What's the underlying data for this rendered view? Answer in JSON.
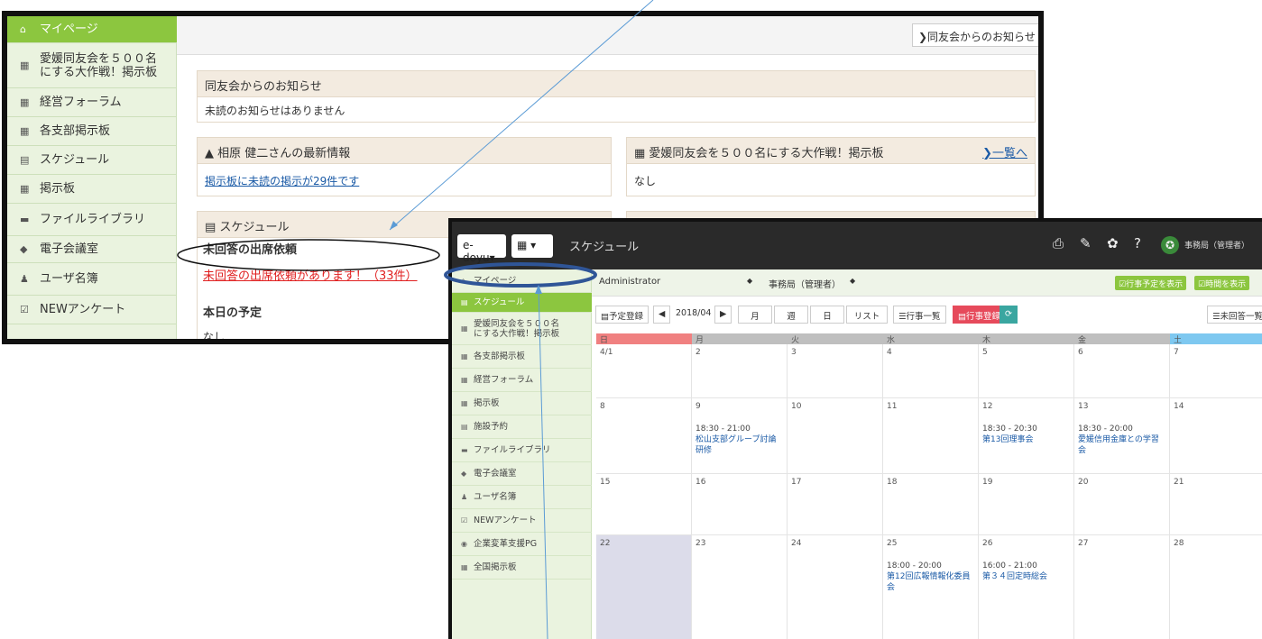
{
  "back": {
    "sidebar": [
      {
        "icon": "home-icon",
        "glyph": "⌂",
        "label": "マイページ",
        "active": true
      },
      {
        "icon": "board-icon",
        "glyph": "▦",
        "label": "愛媛同友会を５００名\nにする大作戦！掲示板"
      },
      {
        "icon": "board-icon",
        "glyph": "▦",
        "label": "経営フォーラム"
      },
      {
        "icon": "board-icon",
        "glyph": "▦",
        "label": "各支部掲示板"
      },
      {
        "icon": "calendar-icon",
        "glyph": "▤",
        "label": "スケジュール"
      },
      {
        "icon": "board-icon",
        "glyph": "▦",
        "label": "掲示板"
      },
      {
        "icon": "folder-icon",
        "glyph": "▬",
        "label": "ファイルライブラリ"
      },
      {
        "icon": "meeting-icon",
        "glyph": "◆",
        "label": "電子会議室"
      },
      {
        "icon": "users-icon",
        "glyph": "♟",
        "label": "ユーザ名簿"
      },
      {
        "icon": "survey-icon",
        "glyph": "☑",
        "label": "NEWアンケート"
      }
    ],
    "top_link": "❯同友会からのお知らせ",
    "news": {
      "title": "同友会からのお知らせ",
      "body": "未読のお知らせはありません"
    },
    "latest": {
      "title": "▲ 相原 健二さんの最新情報",
      "link": "掲示板に未読の掲示が29件です"
    },
    "board": {
      "title": "▦ 愛媛同友会を５００名にする大作戦！掲示板",
      "more": "❯一覧へ",
      "body": "なし"
    },
    "schedule": {
      "title": "▤ スケジュール",
      "s1": "未回答の出席依頼",
      "s1link": "未回答の出席依頼があります！（33件）",
      "s2": "本日の予定",
      "s2body": "なし"
    }
  },
  "front": {
    "top": {
      "group": "e-doyu▾",
      "apps": "▦ ▾",
      "title": "スケジュール",
      "user": "事務局（管理者）"
    },
    "sidebar": [
      {
        "icon": "home-icon",
        "glyph": "⌂",
        "label": "マイページ"
      },
      {
        "icon": "calendar-icon",
        "glyph": "▤",
        "label": "スケジュール",
        "active": true
      },
      {
        "icon": "board-icon",
        "glyph": "▦",
        "label": "愛媛同友会を５００名\nにする大作戦！掲示板"
      },
      {
        "icon": "board-icon",
        "glyph": "▦",
        "label": "各支部掲示板"
      },
      {
        "icon": "board-icon",
        "glyph": "▦",
        "label": "経営フォーラム"
      },
      {
        "icon": "board-icon",
        "glyph": "▦",
        "label": "掲示板"
      },
      {
        "icon": "facility-icon",
        "glyph": "▤",
        "label": "施設予約"
      },
      {
        "icon": "folder-icon",
        "glyph": "▬",
        "label": "ファイルライブラリ"
      },
      {
        "icon": "meeting-icon",
        "glyph": "◆",
        "label": "電子会議室"
      },
      {
        "icon": "users-icon",
        "glyph": "♟",
        "label": "ユーザ名簿"
      },
      {
        "icon": "survey-icon",
        "glyph": "☑",
        "label": "NEWアンケート"
      },
      {
        "icon": "support-icon",
        "glyph": "◉",
        "label": "企業変革支援PG"
      },
      {
        "icon": "board-icon",
        "glyph": "▦",
        "label": "全国掲示板"
      }
    ],
    "filter": {
      "user": "Administrator",
      "group": "事務局（管理者）",
      "show_plan": "☑行事予定を表示",
      "show_time": "☑時間を表示"
    },
    "toolbar": {
      "register": "▤予定登録",
      "prev": "◀",
      "month": "2018/04",
      "next": "▶",
      "m": "月",
      "w": "週",
      "d": "日",
      "list": "リスト",
      "events": "☰行事一覧",
      "event_reg": "▤行事登録",
      "refresh": "⟳",
      "unanswered": "☰未回答一覧"
    },
    "days": [
      "日",
      "月",
      "火",
      "水",
      "木",
      "金",
      "土"
    ],
    "weeks": [
      {
        "dates": [
          "4/1",
          "2",
          "3",
          "4",
          "5",
          "6",
          "7"
        ],
        "events": [
          [],
          [],
          [],
          [],
          [],
          [],
          []
        ]
      },
      {
        "dates": [
          "8",
          "9",
          "10",
          "11",
          "12",
          "13",
          "14"
        ],
        "events": [
          [],
          [
            {
              "t": "18:30 - 21:00",
              "n": "松山支部グループ討論研修"
            }
          ],
          [],
          [],
          [
            {
              "t": "18:30 - 20:30",
              "n": "第13回理事会"
            }
          ],
          [
            {
              "t": "18:30 - 20:00",
              "n": "愛媛信用金庫との学習会"
            }
          ],
          []
        ]
      },
      {
        "dates": [
          "15",
          "16",
          "17",
          "18",
          "19",
          "20",
          "21"
        ],
        "events": [
          [],
          [],
          [],
          [],
          [],
          [],
          []
        ]
      },
      {
        "dates": [
          "22",
          "23",
          "24",
          "25",
          "26",
          "27",
          "28"
        ],
        "events": [
          [],
          [],
          [],
          [
            {
              "t": "18:00 - 20:00",
              "n": "第12回広報情報化委員会"
            }
          ],
          [
            {
              "t": "16:00 - 21:00",
              "n": "第３４回定時総会"
            }
          ],
          [],
          []
        ]
      }
    ]
  },
  "colors": {
    "accent": "#8cc63f",
    "sunday": "#f08080",
    "saturday": "#7ec8f0",
    "event": "#1a5aa6"
  }
}
